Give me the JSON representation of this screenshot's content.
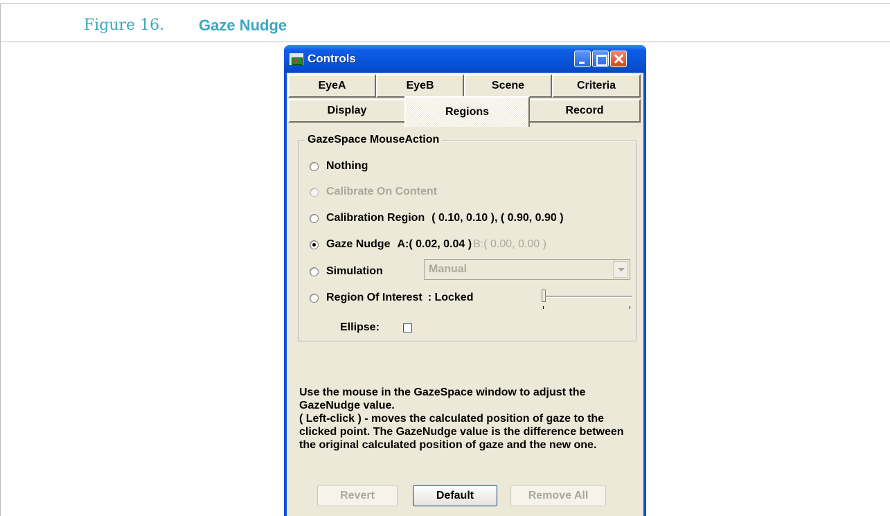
{
  "document": {
    "figure_number": "Figure 16.",
    "figure_title": "Gaze Nudge"
  },
  "window": {
    "title": "Controls",
    "icon": "controls-app-icon",
    "buttons": [
      "minimize",
      "maximize",
      "close"
    ]
  },
  "tabs": {
    "row1": [
      "EyeA",
      "EyeB",
      "Scene",
      "Criteria"
    ],
    "row2": [
      "Display",
      "Regions",
      "Record"
    ],
    "selected": "Regions"
  },
  "group": {
    "title": "GazeSpace MouseAction",
    "options": {
      "nothing": "Nothing",
      "calibrate_on_content": "Calibrate On Content",
      "calibration_region": "Calibration Region",
      "calibration_region_values": "( 0.10, 0.10 ), ( 0.90, 0.90 )",
      "gaze_nudge": "Gaze Nudge",
      "gaze_nudge_a": "A:( 0.02, 0.04 )",
      "gaze_nudge_b": "B:( 0.00, 0.00 )",
      "simulation": "Simulation",
      "simulation_value": "Manual",
      "region_of_interest": "Region Of Interest",
      "region_of_interest_state": ": Locked",
      "ellipse_label": "Ellipse:"
    },
    "selected_option": "Gaze Nudge",
    "disabled_options": [
      "Calibrate On Content"
    ],
    "ellipse_checked": false
  },
  "help_text": {
    "line1": "Use the mouse in the GazeSpace window to adjust the GazeNudge value.",
    "line2": "( Left-click ) - moves the calculated position of gaze to the clicked point. The GazeNudge value is the difference between the original calculated position of gaze and the new one."
  },
  "buttons": {
    "revert": "Revert",
    "default": "Default",
    "remove_all": "Remove All"
  },
  "colors": {
    "figure_accent": "#3aa8c1",
    "titlebar": "#0a55da",
    "dialog_face": "#ece9d8",
    "disabled_text": "#aca899"
  }
}
